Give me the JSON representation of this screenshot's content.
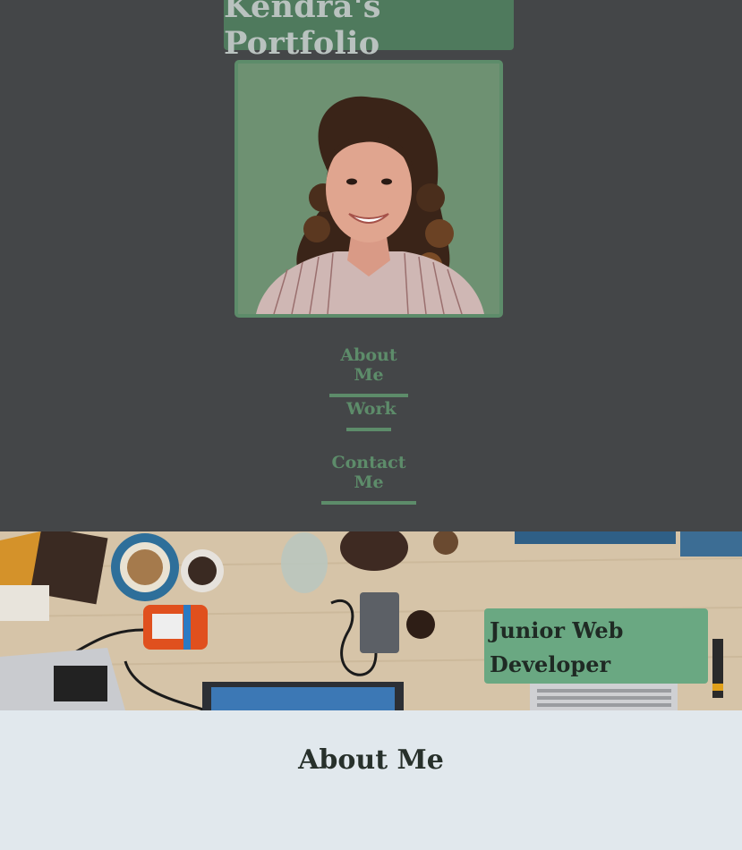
{
  "header": {
    "title": "Kendra's Portfolio"
  },
  "nav": {
    "items": [
      "About Me",
      "Work",
      "Contact Me"
    ]
  },
  "hero": {
    "badge_text": "Junior Web Developer"
  },
  "about": {
    "heading": "About Me"
  },
  "colors": {
    "page_background": "#444648",
    "accent_green": "#5d8c6a",
    "badge_green": "#6aa882",
    "about_background": "#e1e8ed"
  }
}
